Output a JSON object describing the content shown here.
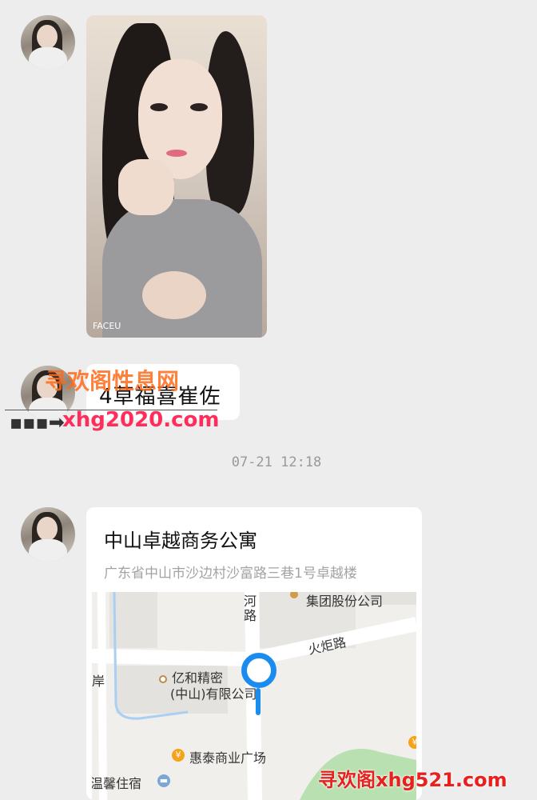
{
  "messages": {
    "photo_brand": "FACEU",
    "text_message": "4草福喜崔佐",
    "timestamp": "07-21 12:18",
    "location": {
      "title": "中山卓越商务公寓",
      "address": "广东省中山市沙边村沙富路三巷1号卓越楼",
      "map_labels": {
        "river_top": "河",
        "river_bottom": "路",
        "group_company": "集团股份公司",
        "road": "火炬路",
        "company_line1": "亿和精密",
        "company_line2": "(中山)有限公司",
        "plaza": "惠泰商业广场",
        "lodging": "温馨住宿",
        "left_edge": "岸"
      }
    }
  },
  "watermarks": {
    "top": "寻欢阁性息网",
    "url": "xhg2020.com",
    "bottom": "寻欢阁xhg521.com"
  },
  "colors": {
    "background": "#ededed",
    "bubble": "#ffffff",
    "pin": "#1a8cf0",
    "poi": "#f4a31a"
  }
}
